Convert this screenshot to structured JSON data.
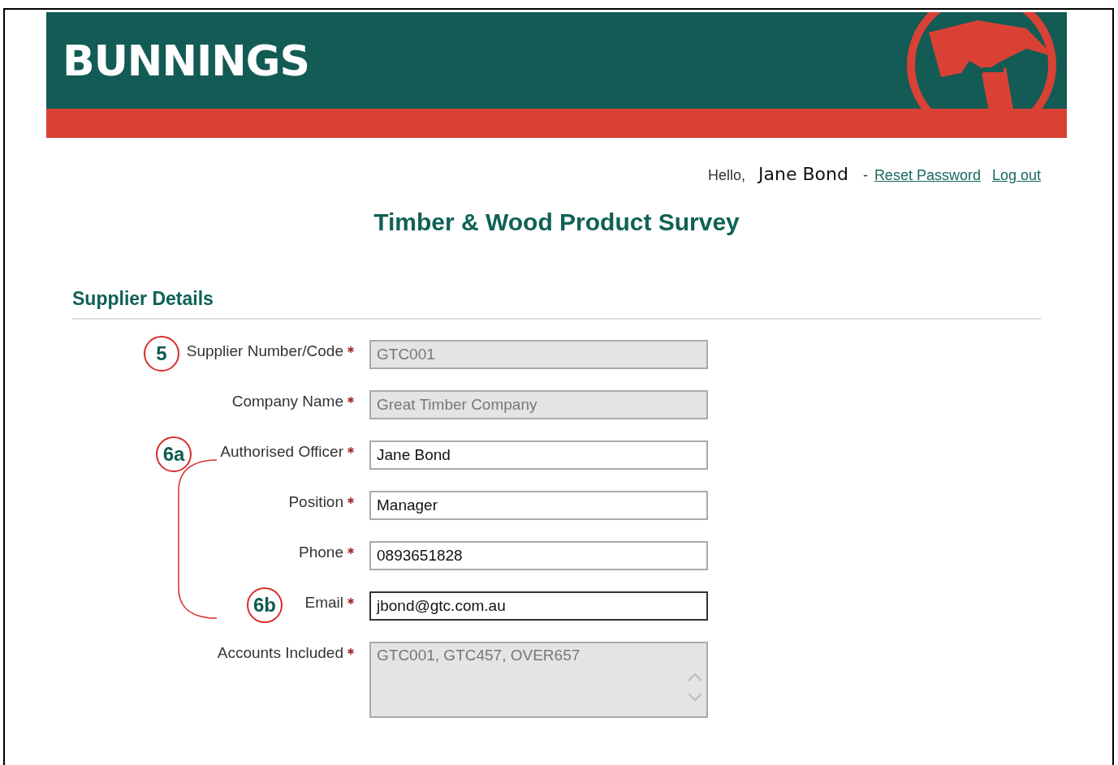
{
  "header": {
    "logo": "BUNNINGS"
  },
  "user_bar": {
    "greeting": "Hello,",
    "user_name": "Jane Bond",
    "separator": "-",
    "links": [
      "Reset Password",
      "Log out"
    ]
  },
  "title": "Timber & Wood Product Survey",
  "section": {
    "title": "Supplier Details",
    "fields": [
      {
        "kind": "input",
        "label": "Supplier Number/Code",
        "required": true,
        "value": "GTC001",
        "disabled": true,
        "focused": false,
        "callout": "5"
      },
      {
        "kind": "input",
        "label": "Company Name",
        "required": true,
        "value": "Great Timber Company",
        "disabled": true,
        "focused": false
      },
      {
        "kind": "input",
        "label": "Authorised Officer",
        "required": true,
        "value": "Jane Bond",
        "disabled": false,
        "focused": false,
        "callout": "6a"
      },
      {
        "kind": "input",
        "label": "Position",
        "required": true,
        "value": "Manager",
        "disabled": false,
        "focused": false
      },
      {
        "kind": "input",
        "label": "Phone",
        "required": true,
        "value": "0893651828",
        "disabled": false,
        "focused": false
      },
      {
        "kind": "input",
        "label": "Email",
        "required": true,
        "value": "jbond@gtc.com.au",
        "disabled": false,
        "focused": true,
        "callout": "6b"
      },
      {
        "kind": "textarea",
        "label": "Accounts Included",
        "required": true,
        "value": "GTC001, GTC457, OVER657",
        "disabled": true,
        "focused": false
      }
    ]
  }
}
